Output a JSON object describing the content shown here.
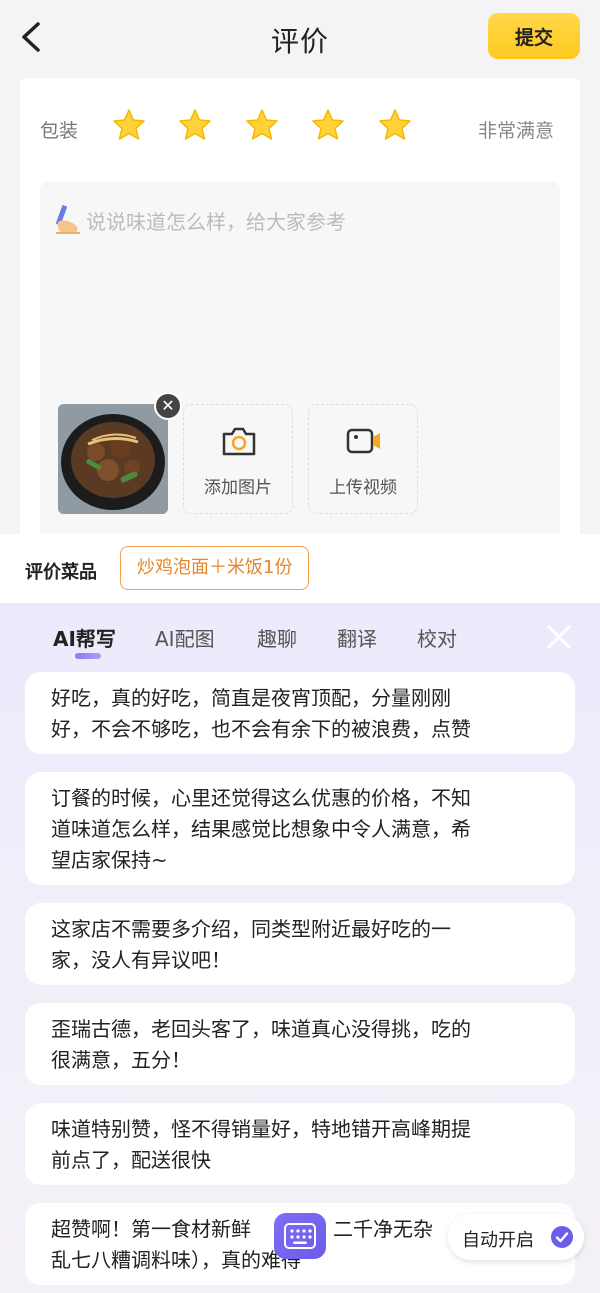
{
  "header": {
    "title": "评价",
    "submit_label": "提交"
  },
  "rating": {
    "label": "包装",
    "stars": 5,
    "max_stars": 5,
    "text": "非常满意",
    "star_color": "#ffd23a"
  },
  "review": {
    "placeholder": "说说味道怎么样，给大家参考",
    "icon": "writing-hand-icon"
  },
  "media": {
    "add_photo_label": "添加图片",
    "upload_video_label": "上传视频"
  },
  "dish": {
    "label": "评价菜品",
    "item": "炒鸡泡面＋米饭1份",
    "accent": "#e8862a"
  },
  "ai_panel": {
    "tabs": [
      "AI帮写",
      "AI配图",
      "趣聊",
      "翻译",
      "校对"
    ],
    "active_tab": "AI帮写",
    "suggestions": [
      [
        "好吃，真的好吃，简直是夜宵顶配，分量刚刚",
        "好，不会不够吃，也不会有余下的被浪费，点赞"
      ],
      [
        "订餐的时候，心里还觉得这么优惠的价格，不知",
        "道味道怎么样，结果感觉比想象中令人满意，希",
        "望店家保持~"
      ],
      [
        "这家店不需要多介绍，同类型附近最好吃的一",
        "家，没人有异议吧！"
      ],
      [
        "歪瑞古德，老回头客了，味道真心没得挑，吃的",
        "很满意，五分！"
      ],
      [
        "味道特别赞，怪不得销量好，特地错开高峰期提",
        "前点了，配送很快"
      ],
      [
        "超赞啊！第一食材新鲜",
        "乱七八糟调料味），真的难得"
      ]
    ],
    "last_suggestion_fragment": "二千净无杂",
    "auto_open_label": "自动开启",
    "accent": "#6a5de8"
  }
}
